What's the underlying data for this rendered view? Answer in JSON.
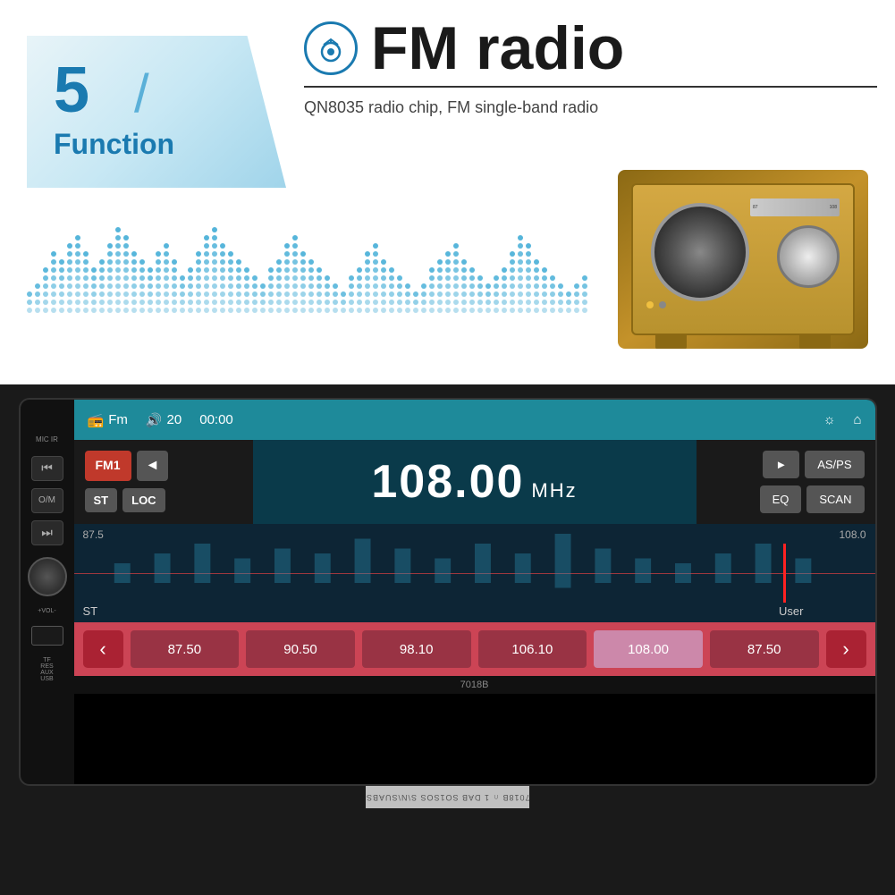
{
  "badge": {
    "number": "5",
    "slash": "/",
    "text": "Function"
  },
  "header": {
    "icon_label": "radio-icon",
    "title": "FM radio",
    "divider": true,
    "subtitle": "QN8035 radio chip, FM single-band radio"
  },
  "device": {
    "model": "7018B",
    "mic_ir": "MIC  IR",
    "side_labels": {
      "vol": "+VOL-",
      "tf": "TF",
      "aux": "AUX",
      "usb": "USB",
      "res": "RES"
    },
    "screen": {
      "top_bar": {
        "mode_icon": "📻",
        "mode_label": "Fm",
        "volume_icon": "🔊",
        "volume_value": "20",
        "time": "00:00",
        "brightness_icon": "☼",
        "home_icon": "⌂"
      },
      "fm_controls": {
        "band_btn": "FM1",
        "prev_btn": "◄",
        "next_btn": "►",
        "st_btn": "ST",
        "loc_btn": "LOC",
        "play_btn": "►",
        "asps_btn": "AS/PS",
        "eq_btn": "EQ",
        "scan_btn": "SCAN"
      },
      "frequency": {
        "value": "108.00",
        "unit": "MHz"
      },
      "spectrum": {
        "left_label": "87.5",
        "right_label": "108.0",
        "bottom_left": "ST",
        "bottom_right": "User"
      },
      "presets": {
        "prev_btn": "‹",
        "next_btn": "›",
        "frequencies": [
          "87.50",
          "90.50",
          "98.10",
          "106.10",
          "108.00",
          "87.50"
        ],
        "active_index": 4
      }
    }
  },
  "bottom_text": "7018B  SDAB ∩1  SO1SOS  S\\\\N\\SUABS"
}
